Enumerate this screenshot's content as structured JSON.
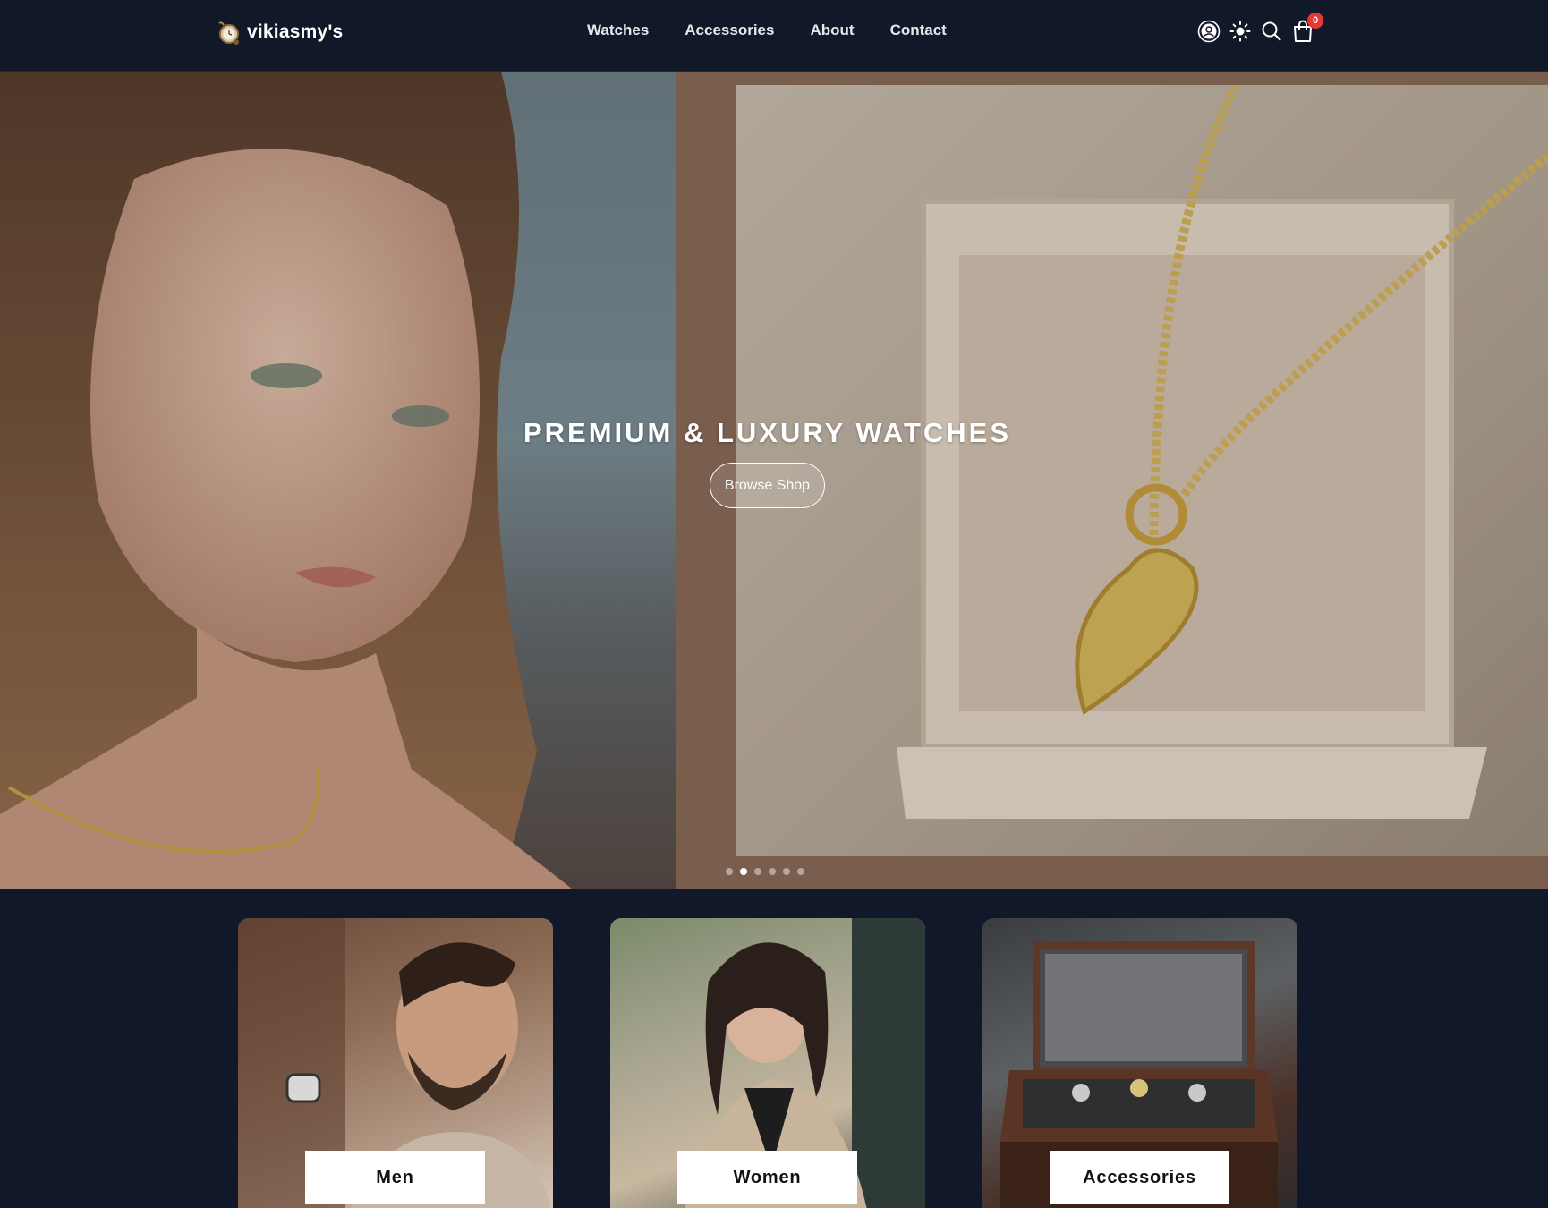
{
  "brand": {
    "name": "vikiasmy's",
    "logo_icon": "pocket-watch-icon"
  },
  "nav": {
    "items": [
      "Watches",
      "Accessories",
      "About",
      "Contact"
    ]
  },
  "header_icons": {
    "account": "user-circle-icon",
    "theme": "sun-icon",
    "search": "search-icon",
    "cart": "shopping-bag-icon",
    "cart_count": "0"
  },
  "hero": {
    "title": "PREMIUM & LUXURY WATCHES",
    "button_label": "Browse Shop",
    "slides_total": 6,
    "active_slide": 2
  },
  "categories": [
    {
      "label": "Men"
    },
    {
      "label": "Women"
    },
    {
      "label": "Accessories"
    }
  ],
  "colors": {
    "header_bg": "#111827",
    "page_bg": "#101829",
    "badge": "#e53935"
  }
}
